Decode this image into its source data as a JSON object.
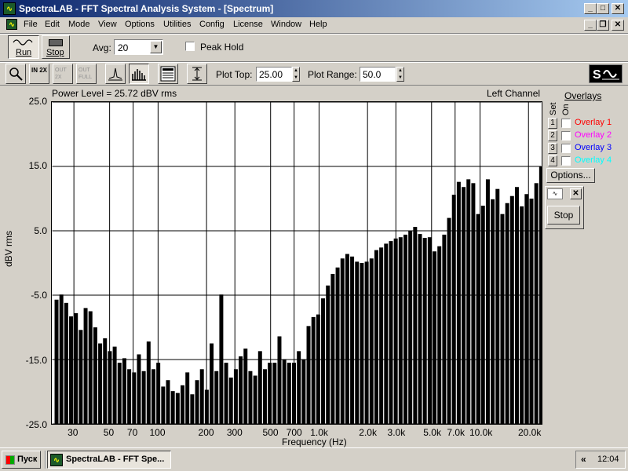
{
  "window": {
    "title": "SpectraLAB - FFT Spectral Analysis System - [Spectrum]",
    "icon": "spectralab-app-icon"
  },
  "menu": [
    "File",
    "Edit",
    "Mode",
    "View",
    "Options",
    "Utilities",
    "Config",
    "License",
    "Window",
    "Help"
  ],
  "toolbar1": {
    "run_label": "Run",
    "stop_label": "Stop",
    "avg_label": "Avg:",
    "avg_value": "20",
    "peak_hold_label": "Peak Hold"
  },
  "toolbar2": {
    "plot_top_label": "Plot Top:",
    "plot_top_value": "25.00",
    "plot_range_label": "Plot Range:",
    "plot_range_value": "50.0",
    "zoom_in_label": "IN 2X",
    "zoom_out_label": "OUT 2X",
    "zoom_full_label": "OUT FULL"
  },
  "plot": {
    "power_level": "Power Level = 25.72 dBV rms",
    "channel": "Left Channel",
    "ylabel": "dBV rms",
    "xlabel": "Frequency (Hz)"
  },
  "overlays": {
    "title": "Overlays",
    "set_label": "Set",
    "on_label": "On",
    "options_label": "Options...",
    "items": [
      {
        "num": "1",
        "label": "Overlay 1",
        "color": "#ff0000"
      },
      {
        "num": "2",
        "label": "Overlay 2",
        "color": "#ff00ff"
      },
      {
        "num": "3",
        "label": "Overlay 3",
        "color": "#0000ff"
      },
      {
        "num": "4",
        "label": "Overlay 4",
        "color": "#00ffff"
      }
    ]
  },
  "mini_panel": {
    "stop_label": "Stop"
  },
  "taskbar": {
    "start_label": "Пуск",
    "task_label": "SpectraLAB - FFT Spe...",
    "clock": "12:04",
    "tray_arrows": "«"
  },
  "chart_data": {
    "type": "bar",
    "x_scale": "log",
    "xlim": [
      22,
      24000
    ],
    "ylim": [
      -25,
      25
    ],
    "y_ticks": [
      "25.0",
      "15.0",
      "5.0",
      "-5.0",
      "-15.0",
      "-25.0"
    ],
    "x_ticks": [
      "30",
      "50",
      "70",
      "100",
      "200",
      "300",
      "500",
      "700",
      "1.0k",
      "2.0k",
      "3.0k",
      "5.0k",
      "7.0k",
      "10.0k",
      "20.0k"
    ],
    "x_tick_values": [
      30,
      50,
      70,
      100,
      200,
      300,
      500,
      700,
      1000,
      2000,
      3000,
      5000,
      7000,
      10000,
      20000
    ],
    "grid": true,
    "series": [
      {
        "values": [
          -5.7,
          -4.9,
          -6.2,
          -8.3,
          -7.8,
          -10.4,
          -7.0,
          -7.5,
          -10.0,
          -12.5,
          -11.7,
          -13.7,
          -13.0,
          -15.5,
          -14.8,
          -16.5,
          -17.0,
          -14.2,
          -16.8,
          -12.2,
          -16.5,
          -15.5,
          -19.2,
          -18.2,
          -19.9,
          -20.2,
          -19.0,
          -17.0,
          -20.4,
          -18.2,
          -16.5,
          -19.7,
          -12.5,
          -16.8,
          -4.9,
          -15.5,
          -17.8,
          -16.5,
          -14.5,
          -13.3,
          -16.8,
          -17.5,
          -13.7,
          -16.5,
          -15.5,
          -15.5,
          -11.4,
          -15.0,
          -15.5,
          -15.5,
          -13.7,
          -15.0,
          -9.8,
          -8.4,
          -8.0,
          -5.5,
          -3.5,
          -1.7,
          -0.7,
          0.7,
          1.4,
          1.0,
          0.2,
          0.0,
          0.2,
          0.7,
          2.0,
          2.4,
          3.0,
          3.4,
          3.8,
          4.0,
          4.4,
          5.0,
          5.6,
          4.5,
          3.9,
          4.0,
          1.8,
          2.6,
          4.4,
          7.0,
          10.6,
          12.6,
          11.8,
          13.0,
          12.4,
          7.6,
          8.9,
          13.0,
          9.9,
          11.5,
          7.6,
          9.3,
          10.4,
          11.8,
          8.8,
          10.7,
          10.0,
          12.4,
          15.0,
          13.7,
          15.2,
          12.4,
          10.7,
          7.0,
          -5.2
        ],
        "freq_start": 23.4,
        "freq_step_octaves": 0.1
      }
    ]
  }
}
